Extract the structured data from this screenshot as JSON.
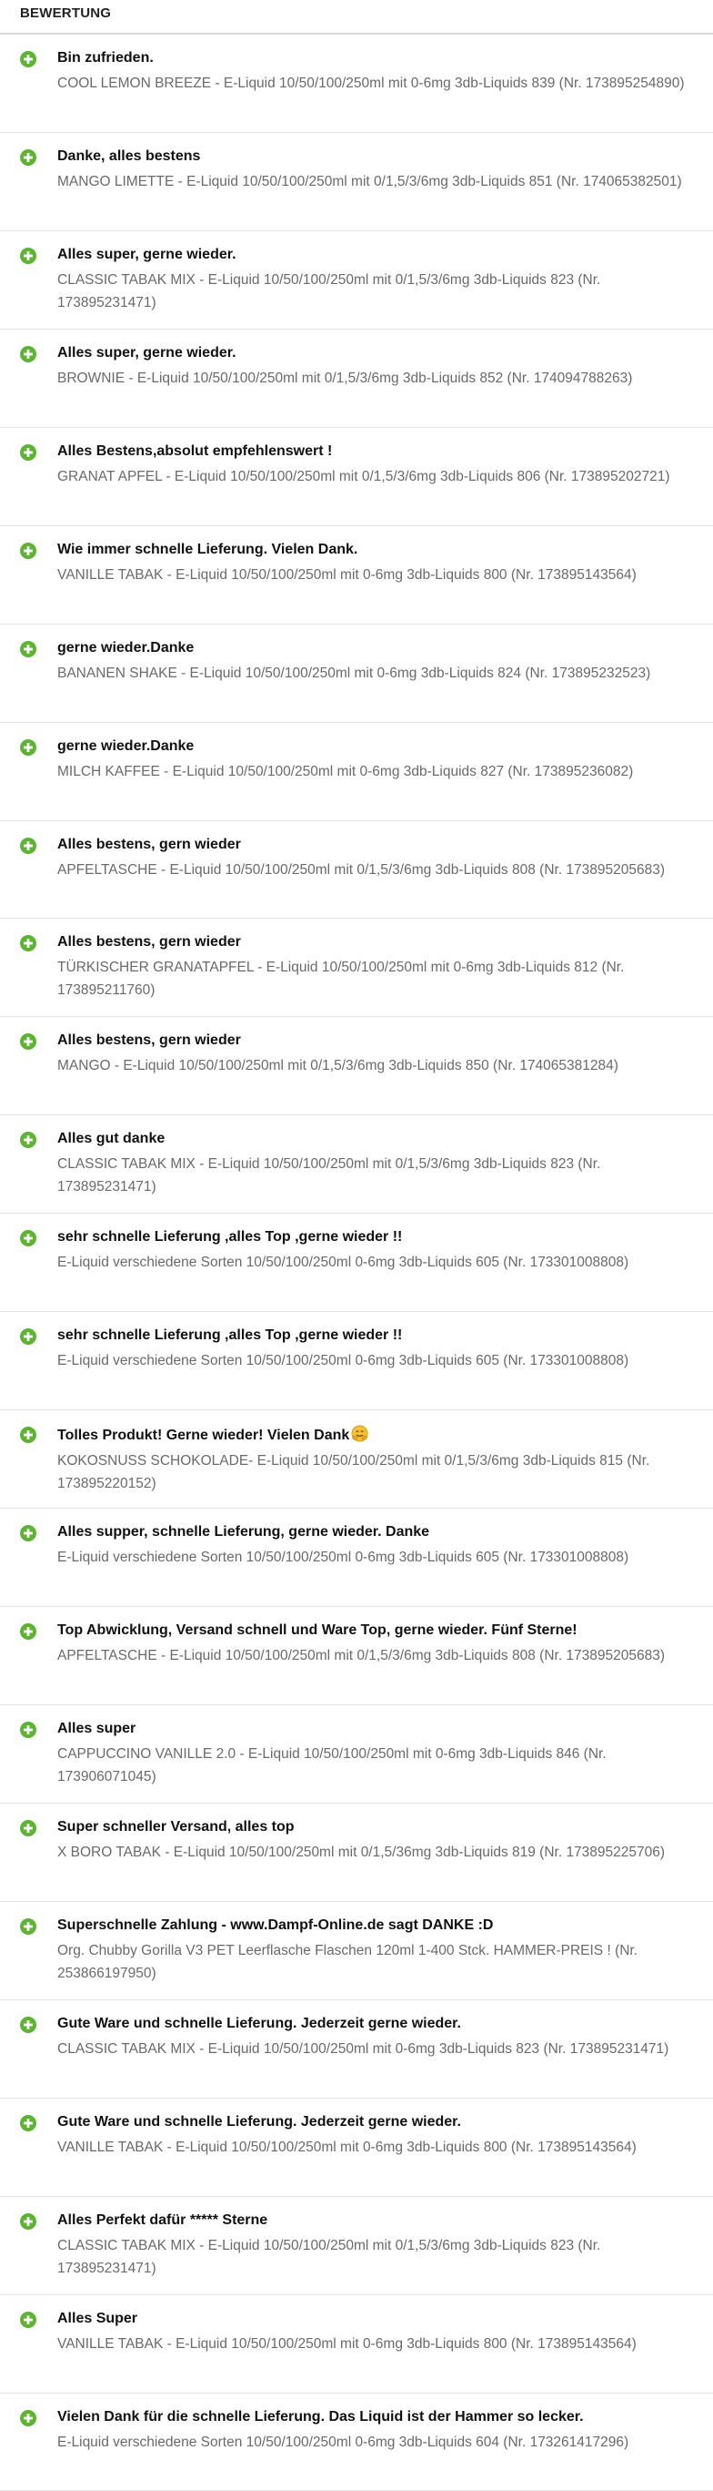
{
  "header": {
    "title": "BEWERTUNG"
  },
  "colors": {
    "positive_icon": "#5cb531",
    "title": "#111111",
    "item": "#6a6a6a",
    "divider": "#e3e3e3"
  },
  "icons": {
    "positive": "plus-circle-icon",
    "emoji": "hugging-face-emoji"
  },
  "reviews": [
    {
      "title": "Bin zufrieden.",
      "item": "COOL LEMON BREEZE - E-Liquid 10/50/100/250ml mit 0-6mg 3db-Liquids 839 (Nr. 173895254890)"
    },
    {
      "title": "Danke, alles bestens",
      "item": "MANGO LIMETTE - E-Liquid 10/50/100/250ml mit 0/1,5/3/6mg 3db-Liquids 851 (Nr. 174065382501)"
    },
    {
      "title": "Alles super, gerne wieder.",
      "item": "CLASSIC TABAK MIX - E-Liquid 10/50/100/250ml mit 0/1,5/3/6mg 3db-Liquids 823 (Nr. 173895231471)"
    },
    {
      "title": "Alles super, gerne wieder.",
      "item": "BROWNIE - E-Liquid 10/50/100/250ml mit 0/1,5/3/6mg 3db-Liquids 852 (Nr. 174094788263)"
    },
    {
      "title": "Alles Bestens,absolut empfehlenswert !",
      "item": "GRANAT APFEL - E-Liquid 10/50/100/250ml mit 0/1,5/3/6mg 3db-Liquids 806 (Nr. 173895202721)"
    },
    {
      "title": "Wie immer schnelle Lieferung. Vielen Dank.",
      "item": "VANILLE TABAK - E-Liquid 10/50/100/250ml mit 0-6mg 3db-Liquids 800 (Nr. 173895143564)"
    },
    {
      "title": "gerne wieder.Danke",
      "item": "BANANEN SHAKE - E-Liquid 10/50/100/250ml mit 0-6mg 3db-Liquids 824 (Nr. 173895232523)"
    },
    {
      "title": "gerne wieder.Danke",
      "item": "MILCH KAFFEE - E-Liquid 10/50/100/250ml mit 0-6mg 3db-Liquids 827 (Nr. 173895236082)"
    },
    {
      "title": "Alles bestens, gern wieder",
      "item": "APFELTASCHE - E-Liquid 10/50/100/250ml mit 0/1,5/3/6mg 3db-Liquids 808 (Nr. 173895205683)"
    },
    {
      "title": "Alles bestens, gern wieder",
      "item": "TÜRKISCHER GRANATAPFEL - E-Liquid 10/50/100/250ml mit 0-6mg 3db-Liquids 812 (Nr. 173895211760)"
    },
    {
      "title": "Alles bestens, gern wieder",
      "item": "MANGO - E-Liquid 10/50/100/250ml mit 0/1,5/3/6mg 3db-Liquids 850 (Nr. 174065381284)"
    },
    {
      "title": "Alles gut danke",
      "item": "CLASSIC TABAK MIX - E-Liquid 10/50/100/250ml mit 0/1,5/3/6mg 3db-Liquids 823 (Nr. 173895231471)"
    },
    {
      "title": "sehr schnelle Lieferung ,alles Top ,gerne wieder !!",
      "item": "E-Liquid verschiedene Sorten 10/50/100/250ml 0-6mg 3db-Liquids 605 (Nr. 173301008808)"
    },
    {
      "title": "sehr schnelle Lieferung ,alles Top ,gerne wieder !!",
      "item": "E-Liquid verschiedene Sorten 10/50/100/250ml 0-6mg 3db-Liquids 605 (Nr. 173301008808)"
    },
    {
      "title": "Tolles Produkt! Gerne wieder! Vielen Dank",
      "item": "KOKOSNUSS SCHOKOLADE- E-Liquid 10/50/100/250ml mit 0/1,5/3/6mg 3db-Liquids 815 (Nr. 173895220152)",
      "emoji": true
    },
    {
      "title": "Alles supper, schnelle Lieferung, gerne wieder. Danke",
      "item": "E-Liquid verschiedene Sorten 10/50/100/250ml 0-6mg 3db-Liquids 605 (Nr. 173301008808)"
    },
    {
      "title": "Top Abwicklung, Versand schnell und Ware Top, gerne wieder. Fünf Sterne!",
      "item": "APFELTASCHE - E-Liquid 10/50/100/250ml mit 0/1,5/3/6mg 3db-Liquids 808 (Nr. 173895205683)"
    },
    {
      "title": "Alles super",
      "item": "CAPPUCCINO VANILLE 2.0 - E-Liquid 10/50/100/250ml mit 0-6mg 3db-Liquids 846 (Nr. 173906071045)"
    },
    {
      "title": "Super schneller Versand, alles top",
      "item": "X BORO TABAK - E-Liquid 10/50/100/250ml mit 0/1,5/36mg 3db-Liquids 819 (Nr. 173895225706)"
    },
    {
      "title": "Superschnelle Zahlung - www.Dampf-Online.de sagt DANKE :D",
      "item": "Org. Chubby Gorilla V3 PET Leerflasche Flaschen 120ml 1-400 Stck. HAMMER-PREIS ! (Nr. 253866197950)"
    },
    {
      "title": "Gute Ware und schnelle Lieferung. Jederzeit gerne wieder.",
      "item": "CLASSIC TABAK MIX - E-Liquid 10/50/100/250ml mit 0-6mg 3db-Liquids 823 (Nr. 173895231471)"
    },
    {
      "title": "Gute Ware und schnelle Lieferung. Jederzeit gerne wieder.",
      "item": "VANILLE TABAK - E-Liquid 10/50/100/250ml mit 0-6mg 3db-Liquids 800 (Nr. 173895143564)"
    },
    {
      "title": "Alles Perfekt dafür ***** Sterne",
      "item": "CLASSIC TABAK MIX - E-Liquid 10/50/100/250ml mit 0/1,5/3/6mg 3db-Liquids 823 (Nr. 173895231471)"
    },
    {
      "title": "Alles Super",
      "item": "VANILLE TABAK - E-Liquid 10/50/100/250ml mit 0-6mg 3db-Liquids 800 (Nr. 173895143564)"
    },
    {
      "title": "Vielen Dank für die schnelle Lieferung. Das Liquid ist der Hammer so lecker.",
      "item": "E-Liquid verschiedene Sorten 10/50/100/250ml 0-6mg 3db-Liquids 604 (Nr. 173261417296)"
    }
  ]
}
